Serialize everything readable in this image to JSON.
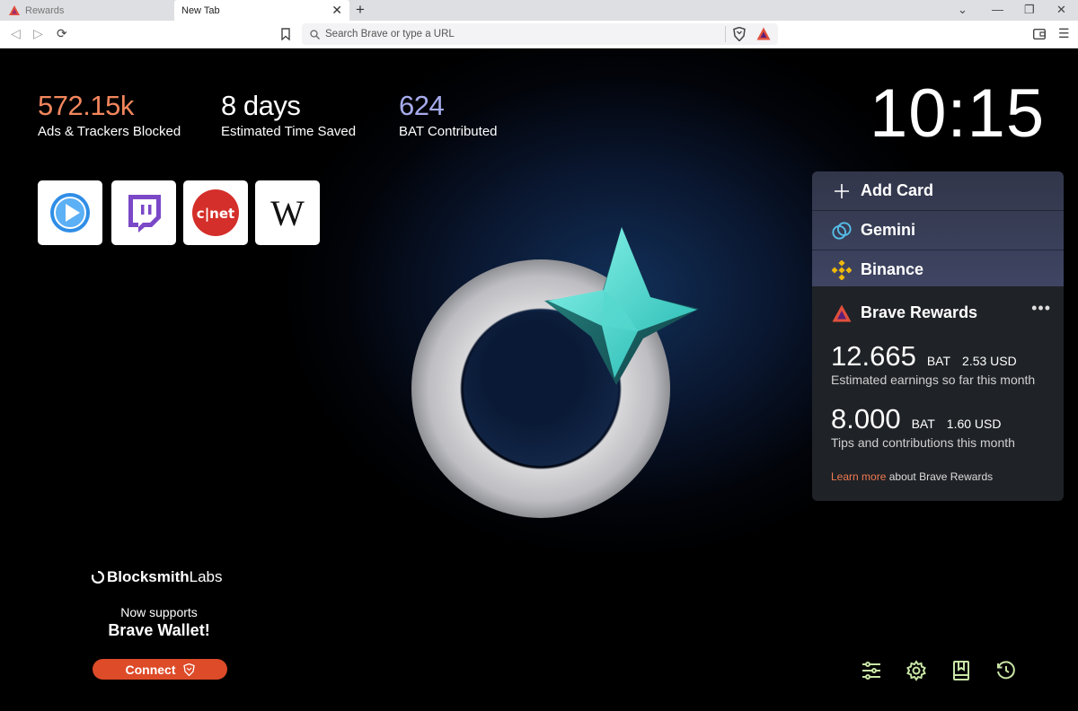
{
  "tabs": [
    {
      "label": "Rewards",
      "icon": "bat-triangle-icon"
    },
    {
      "label": "New Tab",
      "active": true
    }
  ],
  "window": {
    "new_tab": "+",
    "dropdown": "⌄",
    "minimize": "—",
    "restore": "❐",
    "close": "✕"
  },
  "toolbar": {
    "url_placeholder": "Search Brave or type a URL"
  },
  "stats": [
    {
      "value": "572.15k",
      "label": "Ads & Trackers Blocked",
      "color": "#f2865d"
    },
    {
      "value": "8 days",
      "label": "Estimated Time Saved",
      "color": "#ffffff"
    },
    {
      "value": "624",
      "label": "BAT Contributed",
      "color": "#a6abec"
    }
  ],
  "clock": "10:15",
  "top_sites": [
    "video-player-site",
    "twitch",
    "cnet",
    "wikipedia"
  ],
  "cards": {
    "add_card": "Add Card",
    "gemini": "Gemini",
    "binance": "Binance"
  },
  "rewards": {
    "title": "Brave Rewards",
    "more": "•••",
    "earnings": {
      "amount": "12.665",
      "unit": "BAT",
      "usd": "2.53 USD",
      "caption": "Estimated earnings so far this month"
    },
    "tips": {
      "amount": "8.000",
      "unit": "BAT",
      "usd": "1.60 USD",
      "caption": "Tips and contributions this month"
    },
    "learn_link": "Learn more",
    "learn_rest": "about Brave Rewards"
  },
  "sponsor": {
    "brand_bold": "Blocksmith",
    "brand_light": " Labs",
    "line1": "Now supports",
    "line2": "Brave Wallet!",
    "button": "Connect"
  },
  "colors": {
    "accent": "#dd4b29",
    "link": "#f07a52",
    "icon_green": "#c9e6a6"
  }
}
